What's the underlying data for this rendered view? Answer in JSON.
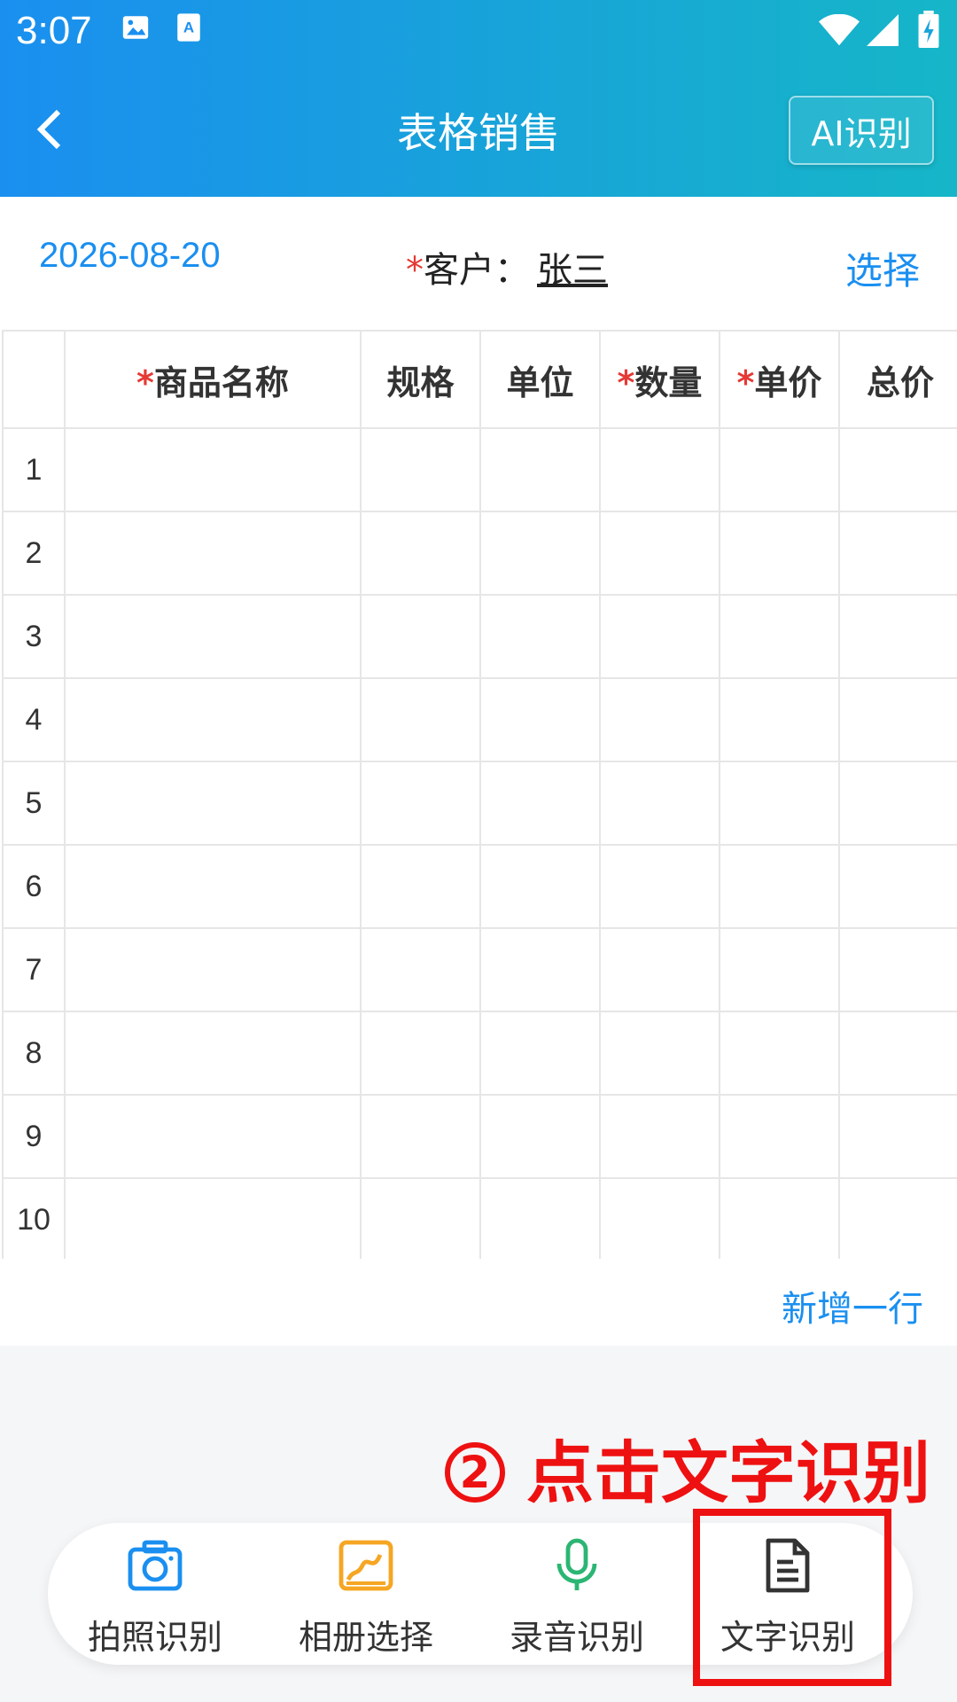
{
  "status": {
    "time": "3:07"
  },
  "header": {
    "title": "表格销售",
    "ai_label": "AI识别"
  },
  "info": {
    "date": "2026-08-20",
    "required_mark": "*",
    "customer_label": "客户：",
    "customer_name": "张三",
    "choose_label": "选择"
  },
  "table": {
    "columns": [
      {
        "label": "商品名称",
        "required": true
      },
      {
        "label": "规格",
        "required": false
      },
      {
        "label": "单位",
        "required": false
      },
      {
        "label": "数量",
        "required": true
      },
      {
        "label": "单价",
        "required": true
      },
      {
        "label": "总价",
        "required": false
      }
    ],
    "rows": [
      "1",
      "2",
      "3",
      "4",
      "5",
      "6",
      "7",
      "8",
      "9",
      "10"
    ]
  },
  "add_row_label": "新增一行",
  "annotation": {
    "number": "2",
    "text": "点击文字识别"
  },
  "actions": [
    {
      "label": "拍照识别",
      "icon": "camera-icon",
      "color": "#1a8ff0"
    },
    {
      "label": "相册选择",
      "icon": "image-icon",
      "color": "#f5a623"
    },
    {
      "label": "录音识别",
      "icon": "microphone-icon",
      "color": "#2bb673"
    },
    {
      "label": "文字识别",
      "icon": "document-icon",
      "color": "#333333"
    }
  ]
}
